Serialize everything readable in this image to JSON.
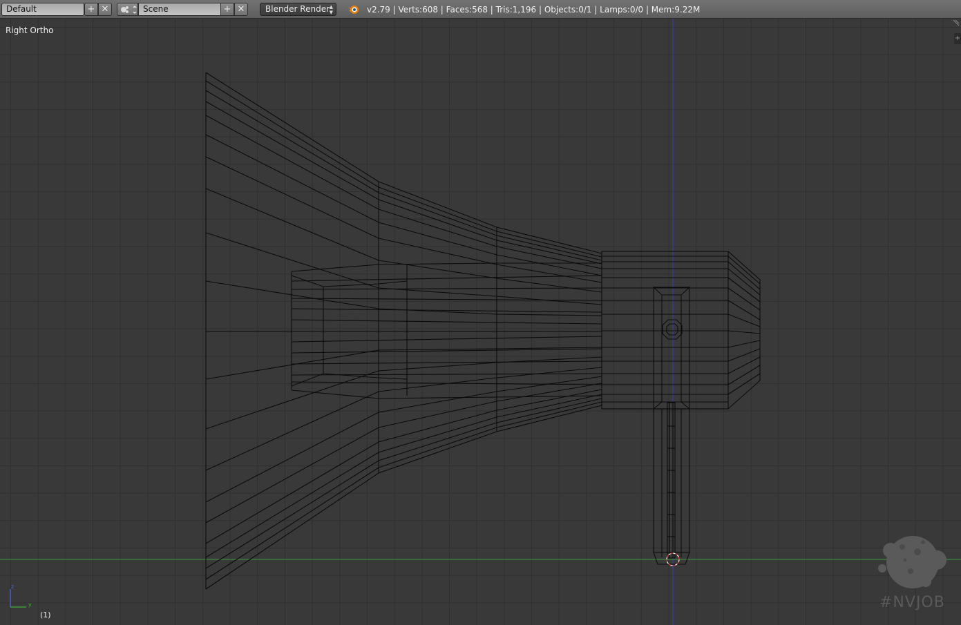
{
  "header": {
    "screen_layout": "Default",
    "scene_name": "Scene",
    "render_engine": "Blender Render",
    "stats": "v2.79 | Verts:608 | Faces:568 | Tris:1,196 | Objects:0/1 | Lamps:0/0 | Mem:9.22M"
  },
  "viewport": {
    "view_name": "Right Ortho",
    "frame": "(1)",
    "axis_z": "z",
    "axis_y": "y"
  },
  "watermark": {
    "text": "#NVJOB"
  },
  "colors": {
    "header_bg": "#6a6a6a",
    "viewport_bg": "#393939",
    "grid_line": "#2f2f2f",
    "wire": "#0b0b0b",
    "z_axis": "#3b3bb8",
    "y_axis": "#3f9a3f",
    "cursor": "#d23b3b"
  }
}
